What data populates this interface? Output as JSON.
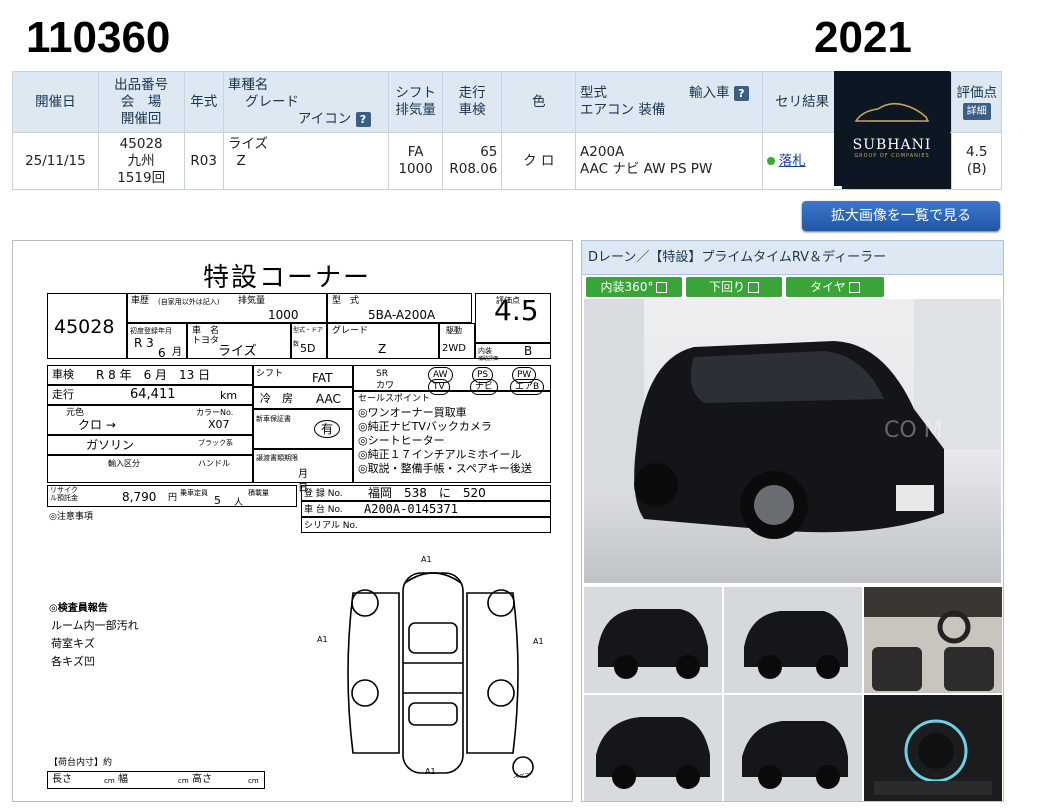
{
  "header": {
    "lot_number": "110360",
    "year": "2021"
  },
  "table": {
    "headers": {
      "date": "開催日",
      "lot_line1": "出品番号",
      "lot_line2": "会　場",
      "lot_line3": "開催回",
      "year_model": "年式",
      "model_line1": "車種名",
      "model_line2": "グレード",
      "model_line3": "アイコン",
      "shift_line1": "シフト",
      "shift_line2": "排気量",
      "mileage_line1": "走行",
      "mileage_line2": "車検",
      "color": "色",
      "type_line1": "型式",
      "type_import": "輸入車",
      "type_line2": "エアコン 装備",
      "result": "セリ結果",
      "eval_line1": "評価点",
      "eval_badge": "詳細"
    },
    "row": {
      "date": "25/11/15",
      "lot": "45028",
      "venue": "九州",
      "session": "1519回",
      "year_model": "R03",
      "model": "ライズ",
      "grade": "Z",
      "shift": "FA",
      "displacement": "1000",
      "mileage": "65",
      "inspection": "R08.06",
      "color": "ク ロ",
      "type": "A200A",
      "equipment": "AAC ナビ AW PS PW",
      "result": "落札",
      "score": "4.5",
      "score_sub": "(B)"
    }
  },
  "logo": {
    "name": "SUBHANI",
    "tagline": "GROUP OF COMPANIES"
  },
  "enlarge_button": "拡大画像を一覧で見る",
  "sheet": {
    "title": "特設コーナー",
    "lot": "45028",
    "history_label": "車歴",
    "history_note": "(自家用以外は記入)",
    "disp_label": "排気量",
    "disp": "1000",
    "type_label": "型　式",
    "type": "5BA-A200A",
    "eval_label": "評価点",
    "eval": "4.5",
    "reg_label": "初度登録年月",
    "reg_year": "R 3",
    "reg_month": "6",
    "reg_unit": "月",
    "name_label": "車　名",
    "maker": "トヨタ",
    "model": "ライズ",
    "doors_label": "型式・ドア数",
    "doors": "5D",
    "grade_label": "グレード",
    "grade": "Z",
    "drive_label": "駆動",
    "drive": "2WD",
    "interior_label": "内装",
    "interior_sub": "補助評価",
    "interior": "B",
    "inspection_label": "車検",
    "inspection": "R 8 年　6 月　13 日",
    "shift_label": "シフト",
    "shift": "FAT",
    "sr": "SR",
    "aw": "AW",
    "ps": "PS",
    "pw": "PW",
    "kawa": "カワ",
    "tv": "TV",
    "navi": "ナビ",
    "ab": "エアB",
    "mileage_label": "走行",
    "mileage": "64,411",
    "mileage_unit": "km",
    "ac_label": "冷　房",
    "ac": "AAC",
    "color_label": "元色",
    "color": "クロ →",
    "colorno_label": "カラーNo.",
    "color_no": "X07",
    "color_sub": "ブラック系",
    "fuel": "ガソリン",
    "warranty_label": "新車保証書",
    "warranty": "有",
    "import_label": "輸入区分",
    "handle_label": "ハンドル",
    "points_label": "セールスポイント",
    "points": [
      "◎ワンオーナー買取車",
      "◎純正ナビTVバックカメラ",
      "◎シートヒーター",
      "◎純正１７インチアルミホイール",
      "◎取説・整備手帳・スペアキー後送"
    ],
    "expire_label": "譲渡書類期限",
    "expire": "月　　　　　日",
    "recycle_label": "リサイクル預託金",
    "recycle": "8,790",
    "recycle_unit": "円",
    "capacity_label": "乗車定員",
    "capacity": "5",
    "capacity_unit": "人",
    "load_label": "積載量",
    "plate_label": "登 録 No.",
    "plate": "福岡　538　に　520",
    "chassis_label": "車 台 No.",
    "chassis": "A200A-0145371",
    "serial_label": "シリアル No.",
    "notice": "◎注意事項",
    "inspector_title": "◎検査員報告",
    "inspector": [
      "ルーム内一部汚れ",
      "荷室キズ",
      "各キズ凹"
    ],
    "a1": "A1",
    "spare": "スペア",
    "cargo_label": "【荷台内寸】約",
    "length_label": "長さ",
    "width_label": "幅",
    "height_label": "高さ",
    "cm": "cm"
  },
  "photos": {
    "title": "Dレーン／【特設】プライムタイムRV＆ディーラー",
    "tabs": [
      "内装360°",
      "下回り",
      "タイヤ"
    ],
    "watermark": "CO M"
  },
  "colors": {
    "header_bg": "#dde8f2",
    "accent": "#3a5f86",
    "button": "#1f56a8",
    "tab_green": "#3aa33a"
  }
}
